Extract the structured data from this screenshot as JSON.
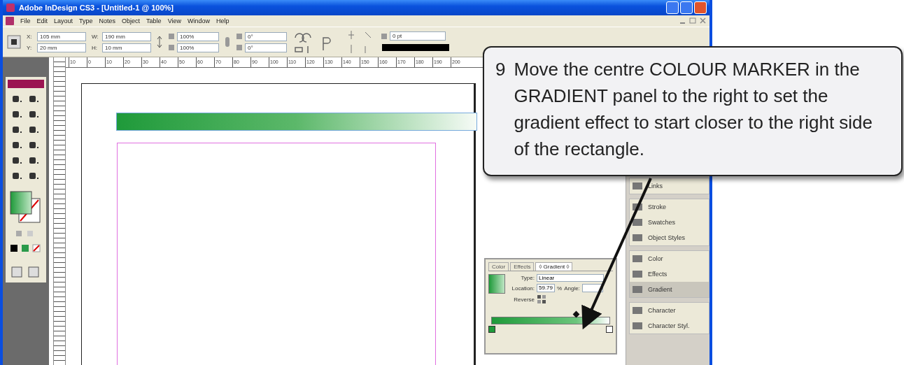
{
  "window": {
    "title": "Adobe InDesign CS3 - [Untitled-1 @ 100%]"
  },
  "menu": [
    "File",
    "Edit",
    "Layout",
    "Type",
    "Notes",
    "Object",
    "Table",
    "View",
    "Window",
    "Help"
  ],
  "control_bar": {
    "fields": [
      {
        "label": "X:",
        "value": "105 mm"
      },
      {
        "label": "Y:",
        "value": "20 mm"
      },
      {
        "label": "W:",
        "value": "190 mm"
      },
      {
        "label": "H:",
        "value": "10 mm"
      },
      {
        "value": "100%"
      },
      {
        "value": "100%"
      },
      {
        "value": "0°"
      },
      {
        "value": "0°"
      },
      {
        "value": "0 pt"
      }
    ]
  },
  "ruler": {
    "labels": [
      "10",
      "0",
      "10",
      "20",
      "30",
      "40",
      "50",
      "60",
      "70",
      "80",
      "90",
      "100",
      "110",
      "120",
      "130",
      "140",
      "150",
      "160",
      "170",
      "180",
      "190",
      "200"
    ]
  },
  "panel_dock": {
    "groups": [
      {
        "items": [
          {
            "label": "Links",
            "selected": false
          }
        ]
      },
      {
        "items": [
          {
            "label": "Stroke",
            "selected": false
          },
          {
            "label": "Swatches",
            "selected": false
          },
          {
            "label": "Object Styles",
            "selected": false
          }
        ]
      },
      {
        "items": [
          {
            "label": "Color",
            "selected": false
          },
          {
            "label": "Effects",
            "selected": false
          },
          {
            "label": "Gradient",
            "selected": true
          }
        ]
      },
      {
        "items": [
          {
            "label": "Character",
            "selected": false
          },
          {
            "label": "Character Styl.",
            "selected": false
          }
        ]
      }
    ]
  },
  "gradient_panel": {
    "tabs": [
      {
        "label": "Color",
        "selected": false
      },
      {
        "label": "Effects",
        "selected": false
      },
      {
        "label": "◊ Gradient ◊",
        "selected": true
      }
    ],
    "type_label": "Type:",
    "type_value": "Linear",
    "location_label": "Location:",
    "location_value": "59.79",
    "percent": "%",
    "angle_label": "Angle:",
    "reverse_label": "Reverse",
    "midpoint": {
      "level": 0.72
    }
  },
  "callout": {
    "number": "9",
    "text": "Move the centre COLOUR MARKER in the GRADIENT panel to the right to set the gradient effect to start closer to the right side of the rectangle."
  }
}
